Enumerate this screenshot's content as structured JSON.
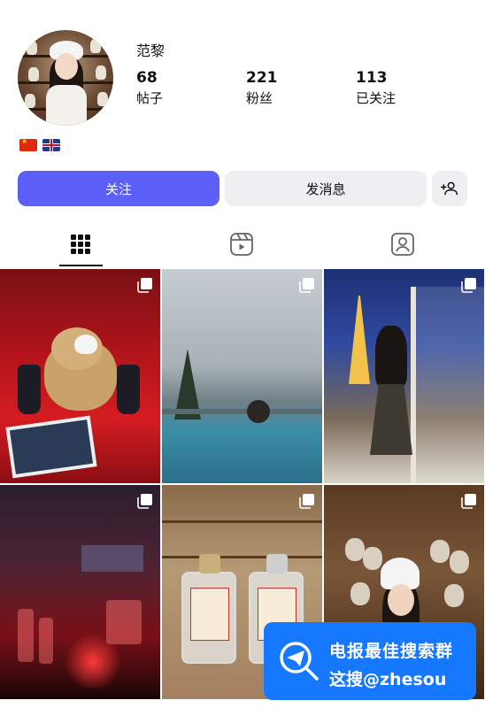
{
  "profile": {
    "username": "范黎",
    "stats": {
      "posts": {
        "value": "68",
        "label": "帖子"
      },
      "followers": {
        "value": "221",
        "label": "粉丝"
      },
      "following": {
        "value": "113",
        "label": "已关注"
      }
    },
    "flags": [
      "cn-flag",
      "uk-flag"
    ]
  },
  "actions": {
    "follow_label": "关注",
    "message_label": "发消息",
    "add_user_icon": "add-user-icon"
  },
  "tabs": [
    {
      "icon": "grid-icon",
      "selected": true
    },
    {
      "icon": "reels-icon",
      "selected": false
    },
    {
      "icon": "tagged-icon",
      "selected": false
    }
  ],
  "posts": [
    {
      "subject": "teddy-bear-phantom",
      "multi": true
    },
    {
      "subject": "infinity-pool",
      "multi": true
    },
    {
      "subject": "eiffel-tower-balcony",
      "multi": true
    },
    {
      "subject": "theater-bar",
      "multi": true
    },
    {
      "subject": "perfume-bottles",
      "multi": true
    },
    {
      "subject": "plush-shop",
      "multi": true
    }
  ],
  "watermark": {
    "line1": "电报最佳搜索群",
    "line2": "这搜@zhesou"
  },
  "colors": {
    "follow_button": "#5b5ff6",
    "secondary_button": "#efeff2",
    "banner": "#1677ff"
  }
}
